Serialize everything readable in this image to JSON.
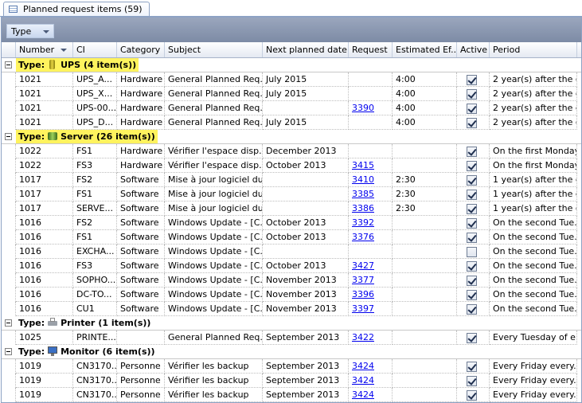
{
  "tab": {
    "label": "Planned request items (59)"
  },
  "group_panel": {
    "chip_label": "Type"
  },
  "columns": [
    "Number",
    "CI",
    "Category",
    "Subject",
    "Next planned date...",
    "Request",
    "Estimated Ef...",
    "Active",
    "Period"
  ],
  "groups": [
    {
      "prefix": "Type:",
      "name": "UPS",
      "count": "(4 item(s))",
      "icon": "ups-battery-icon",
      "highlight": true,
      "rows": [
        {
          "number": "1021",
          "ci": "UPS_A...",
          "category": "Hardware",
          "subject": "General Planned Req...",
          "next_date": "July 2015",
          "request": "",
          "effort": "4:00",
          "active": true,
          "period": "2 year(s) after the c..."
        },
        {
          "number": "1021",
          "ci": "UPS_X...",
          "category": "Hardware",
          "subject": "General Planned Req...",
          "next_date": "July 2015",
          "request": "",
          "effort": "4:00",
          "active": true,
          "period": "2 year(s) after the c..."
        },
        {
          "number": "1021",
          "ci": "UPS-00...",
          "category": "Hardware",
          "subject": "General Planned Req...",
          "next_date": "",
          "request": "3390",
          "effort": "4:00",
          "active": true,
          "period": "2 year(s) after the c..."
        },
        {
          "number": "1021",
          "ci": "UPS_D...",
          "category": "Hardware",
          "subject": "General Planned Req...",
          "next_date": "July 2015",
          "request": "",
          "effort": "4:00",
          "active": true,
          "period": "2 year(s) after the c..."
        }
      ]
    },
    {
      "prefix": "Type:",
      "name": "Server",
      "count": "(26 item(s))",
      "icon": "server-icon",
      "highlight": true,
      "rows": [
        {
          "number": "1022",
          "ci": "FS1",
          "category": "Hardware",
          "subject": "Vérifier l'espace disp...",
          "next_date": "December 2013",
          "request": "",
          "effort": "",
          "active": true,
          "period": "On the first Monday..."
        },
        {
          "number": "1022",
          "ci": "FS3",
          "category": "Hardware",
          "subject": "Vérifier l'espace disp...",
          "next_date": "October 2013",
          "request": "3415",
          "effort": "",
          "active": true,
          "period": "On the first Monday..."
        },
        {
          "number": "1017",
          "ci": "FS2",
          "category": "Software",
          "subject": "Mise à jour logiciel du...",
          "next_date": "",
          "request": "3410",
          "effort": "2:30",
          "active": true,
          "period": "1 year(s) after the c..."
        },
        {
          "number": "1017",
          "ci": "FS1",
          "category": "Software",
          "subject": "Mise à jour logiciel du...",
          "next_date": "",
          "request": "3385",
          "effort": "2:30",
          "active": true,
          "period": "1 year(s) after the c..."
        },
        {
          "number": "1017",
          "ci": "SERVE...",
          "category": "Software",
          "subject": "Mise à jour logiciel du...",
          "next_date": "",
          "request": "3386",
          "effort": "2:30",
          "active": true,
          "period": "1 year(s) after the c..."
        },
        {
          "number": "1016",
          "ci": "FS2",
          "category": "Software",
          "subject": "Windows Update - [C...",
          "next_date": "October 2013",
          "request": "3392",
          "effort": "",
          "active": true,
          "period": "On the second Tue..."
        },
        {
          "number": "1016",
          "ci": "FS1",
          "category": "Software",
          "subject": "Windows Update - [C...",
          "next_date": "October 2013",
          "request": "3376",
          "effort": "",
          "active": true,
          "period": "On the second Tue..."
        },
        {
          "number": "1016",
          "ci": "EXCHA...",
          "category": "Software",
          "subject": "Windows Update - [C...",
          "next_date": "",
          "request": "",
          "effort": "",
          "active": false,
          "period": "On the second Tue..."
        },
        {
          "number": "1016",
          "ci": "FS3",
          "category": "Software",
          "subject": "Windows Update - [C...",
          "next_date": "October 2013",
          "request": "3427",
          "effort": "",
          "active": true,
          "period": "On the second Tue..."
        },
        {
          "number": "1016",
          "ci": "SOPHO...",
          "category": "Software",
          "subject": "Windows Update - [C...",
          "next_date": "November 2013",
          "request": "3377",
          "effort": "",
          "active": true,
          "period": "On the second Tue..."
        },
        {
          "number": "1016",
          "ci": "DC-TO...",
          "category": "Software",
          "subject": "Windows Update - [C...",
          "next_date": "November 2013",
          "request": "3396",
          "effort": "",
          "active": true,
          "period": "On the second Tue..."
        },
        {
          "number": "1016",
          "ci": "CU1",
          "category": "Software",
          "subject": "Windows Update - [C...",
          "next_date": "November 2013",
          "request": "3397",
          "effort": "",
          "active": true,
          "period": "On the second Tue..."
        }
      ]
    },
    {
      "prefix": "Type:",
      "name": "Printer",
      "count": "(1 item(s))",
      "icon": "printer-icon",
      "highlight": false,
      "rows": [
        {
          "number": "1025",
          "ci": "PRINTE...",
          "category": "",
          "subject": "General Planned Req...",
          "next_date": "September 2013",
          "request": "3422",
          "effort": "",
          "active": true,
          "period": "Every Tuesday of e..."
        }
      ]
    },
    {
      "prefix": "Type:",
      "name": "Monitor",
      "count": "(6 item(s))",
      "icon": "monitor-icon",
      "highlight": false,
      "rows": [
        {
          "number": "1019",
          "ci": "CN3170...",
          "category": "Personne",
          "subject": "Vérifier les backup",
          "next_date": "September 2013",
          "request": "3424",
          "effort": "",
          "active": true,
          "period": "Every Friday every..."
        },
        {
          "number": "1019",
          "ci": "CN3170...",
          "category": "Personne",
          "subject": "Vérifier les backup",
          "next_date": "September 2013",
          "request": "3424",
          "effort": "",
          "active": true,
          "period": "Every Friday every..."
        },
        {
          "number": "1019",
          "ci": "CN3170...",
          "category": "Personne",
          "subject": "Vérifier les backup",
          "next_date": "September 2013",
          "request": "3424",
          "effort": "",
          "active": true,
          "period": "Every Friday every..."
        }
      ]
    }
  ]
}
